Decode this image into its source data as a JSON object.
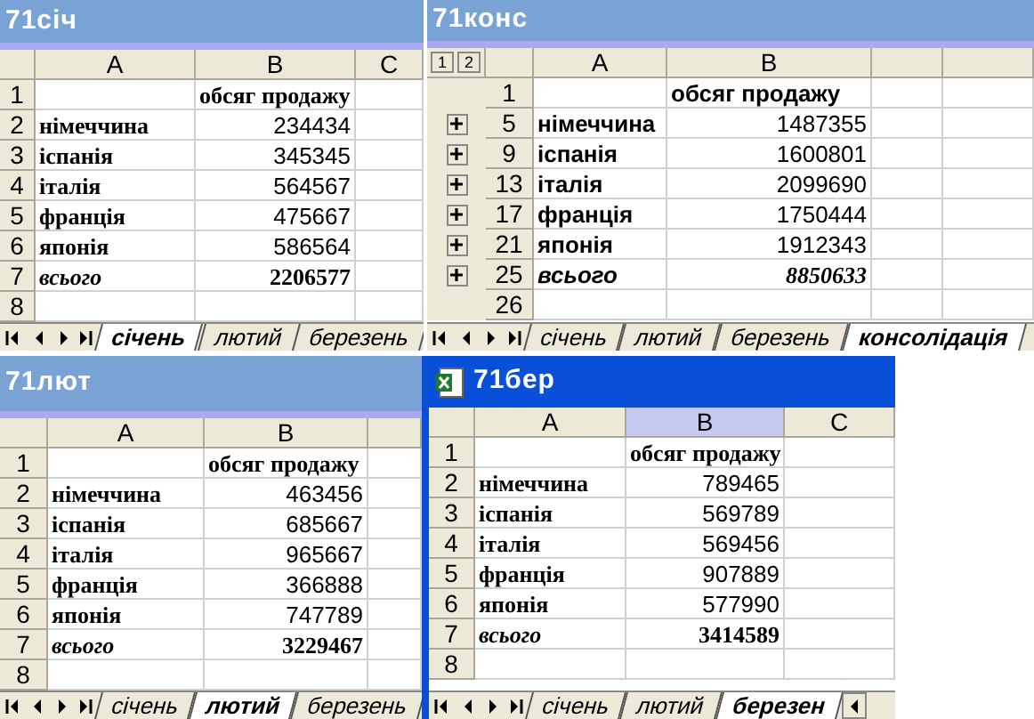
{
  "windows": [
    {
      "title": "71січ",
      "active": false,
      "kind": "sheet",
      "columns": [
        {
          "label": "A",
          "selected": false
        },
        {
          "label": "B",
          "selected": false
        },
        {
          "label": "C",
          "selected": false
        }
      ],
      "rows": [
        {
          "number": "1",
          "label": "",
          "value": "обсяг продажу",
          "kind": "header"
        },
        {
          "number": "2",
          "label": "німеччина",
          "value": "234434",
          "kind": "item"
        },
        {
          "number": "3",
          "label": "іспанія",
          "value": "345345",
          "kind": "item"
        },
        {
          "number": "4",
          "label": "італія",
          "value": "564567",
          "kind": "item"
        },
        {
          "number": "5",
          "label": "франція",
          "value": "475667",
          "kind": "item"
        },
        {
          "number": "6",
          "label": "японія",
          "value": "586564",
          "kind": "item"
        },
        {
          "number": "7",
          "label": "всього",
          "value": "2206577",
          "kind": "total"
        },
        {
          "number": "8",
          "kind": "empty"
        }
      ],
      "tabs": [
        {
          "label": "січень",
          "selected": true
        },
        {
          "label": "лютий",
          "selected": false
        },
        {
          "label": "березень",
          "selected": false
        }
      ]
    },
    {
      "title": "71конс",
      "active": false,
      "kind": "outline",
      "outline_levels": [
        "1",
        "2"
      ],
      "columns": [
        {
          "label": "A",
          "selected": false
        },
        {
          "label": "B",
          "selected": false
        }
      ],
      "rows": [
        {
          "number": "1",
          "label": "",
          "value": "обсяг продажу",
          "kind": "header"
        },
        {
          "number": "5",
          "label": "німеччина",
          "value": "1487355",
          "kind": "item",
          "collapsed": true
        },
        {
          "number": "9",
          "label": "іспанія",
          "value": "1600801",
          "kind": "item",
          "collapsed": true
        },
        {
          "number": "13",
          "label": "італія",
          "value": "2099690",
          "kind": "item",
          "collapsed": true
        },
        {
          "number": "17",
          "label": "франція",
          "value": "1750444",
          "kind": "item",
          "collapsed": true
        },
        {
          "number": "21",
          "label": "японія",
          "value": "1912343",
          "kind": "item",
          "collapsed": true
        },
        {
          "number": "25",
          "label": "всього",
          "value": "8850633",
          "kind": "total",
          "collapsed": true
        },
        {
          "number": "26",
          "kind": "empty"
        }
      ],
      "tabs": [
        {
          "label": "січень",
          "selected": false
        },
        {
          "label": "лютий",
          "selected": false
        },
        {
          "label": "березень",
          "selected": false
        },
        {
          "label": "консолідація",
          "selected": true
        }
      ]
    },
    {
      "title": "71лют",
      "active": false,
      "kind": "sheet",
      "columns": [
        {
          "label": "A",
          "selected": false
        },
        {
          "label": "B",
          "selected": false
        }
      ],
      "rows": [
        {
          "number": "1",
          "label": "",
          "value": "обсяг продажу",
          "kind": "header"
        },
        {
          "number": "2",
          "label": "німеччина",
          "value": "463456",
          "kind": "item"
        },
        {
          "number": "3",
          "label": "іспанія",
          "value": "685667",
          "kind": "item"
        },
        {
          "number": "4",
          "label": "італія",
          "value": "965667",
          "kind": "item"
        },
        {
          "number": "5",
          "label": "франція",
          "value": "366888",
          "kind": "item"
        },
        {
          "number": "6",
          "label": "японія",
          "value": "747789",
          "kind": "item"
        },
        {
          "number": "7",
          "label": "всього",
          "value": "3229467",
          "kind": "total"
        },
        {
          "number": "8",
          "kind": "empty"
        }
      ],
      "tabs": [
        {
          "label": "січень",
          "selected": false
        },
        {
          "label": "лютий",
          "selected": true
        },
        {
          "label": "березень",
          "selected": false
        }
      ]
    },
    {
      "title": "71бер",
      "active": true,
      "kind": "sheet",
      "columns": [
        {
          "label": "A",
          "selected": false
        },
        {
          "label": "B",
          "selected": true
        },
        {
          "label": "C",
          "selected": false
        }
      ],
      "rows": [
        {
          "number": "1",
          "label": "",
          "value": "обсяг продажу",
          "kind": "header"
        },
        {
          "number": "2",
          "label": "німеччина",
          "value": "789465",
          "kind": "item"
        },
        {
          "number": "3",
          "label": "іспанія",
          "value": "569789",
          "kind": "item"
        },
        {
          "number": "4",
          "label": "італія",
          "value": "569456",
          "kind": "item"
        },
        {
          "number": "5",
          "label": "франція",
          "value": "907889",
          "kind": "item"
        },
        {
          "number": "6",
          "label": "японія",
          "value": "577990",
          "kind": "item"
        },
        {
          "number": "7",
          "label": "всього",
          "value": "3414589",
          "kind": "total"
        },
        {
          "number": "8",
          "kind": "empty"
        }
      ],
      "tabs": [
        {
          "label": "січень",
          "selected": false
        },
        {
          "label": "лютий",
          "selected": false
        },
        {
          "label": "березен",
          "selected": true
        }
      ]
    }
  ]
}
